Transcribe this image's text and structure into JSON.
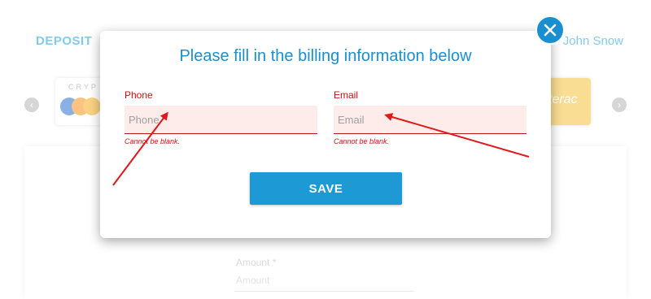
{
  "background": {
    "deposit_label": "DEPOSIT",
    "user_name": "John Snow",
    "crypto_label": "CRYP",
    "interac_label": "terac",
    "amount_label": "Amount *",
    "amount_placeholder": "Amount"
  },
  "modal": {
    "title": "Please fill in the billing information below",
    "phone": {
      "label": "Phone",
      "placeholder": "Phone",
      "value": "",
      "error": "Cannot be blank."
    },
    "email": {
      "label": "Email",
      "placeholder": "Email",
      "value": "",
      "error": "Cannot be blank."
    },
    "save_label": "SAVE",
    "close_icon": "close-icon"
  },
  "colors": {
    "accent": "#1a8fd0",
    "error": "#cc1111",
    "error_field_bg": "#fdecea",
    "annotation_arrow": "#e0191b"
  }
}
